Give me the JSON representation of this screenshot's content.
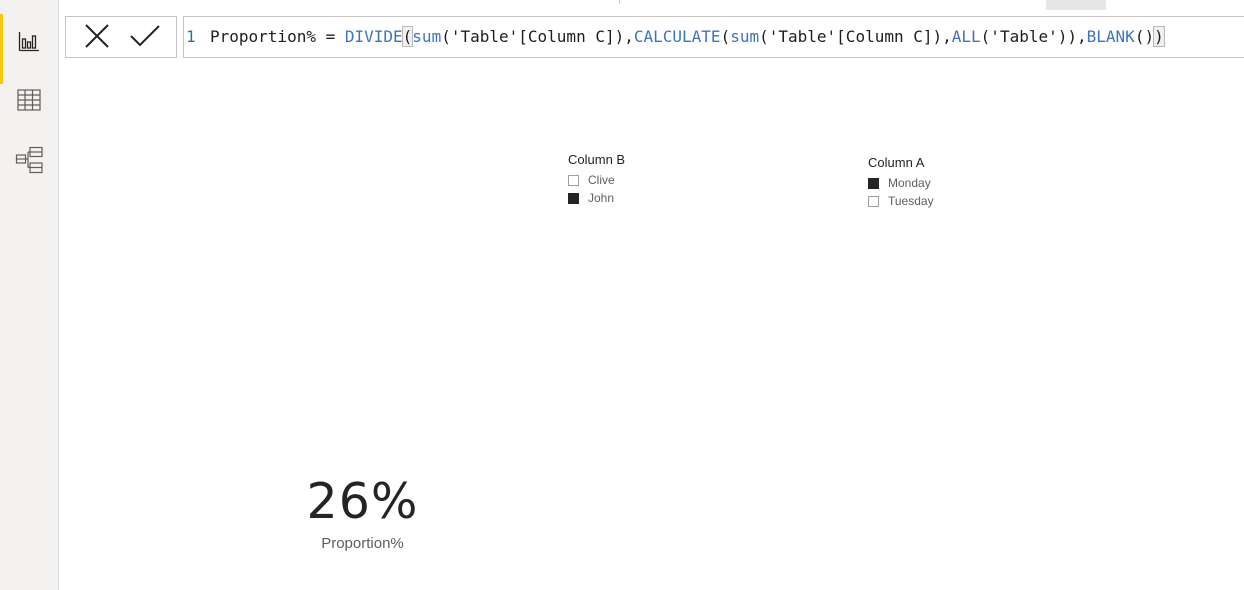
{
  "left_rail": {
    "items": [
      {
        "icon": "report-view-icon",
        "active": true
      },
      {
        "icon": "data-view-icon",
        "active": false
      },
      {
        "icon": "model-view-icon",
        "active": false
      }
    ]
  },
  "formula_bar": {
    "cancel_icon": "close-icon",
    "commit_icon": "checkmark-icon",
    "line_number": "1",
    "tokens": {
      "t1": "Proportion% = ",
      "t2": "DIVIDE",
      "t3": "(",
      "t4": "sum",
      "t5": "('Table'[Column C]),",
      "t6": "CALCULATE",
      "t7": "(",
      "t8": "sum",
      "t9": "('Table'[Column C]),",
      "t10": "ALL",
      "t11": "('Table')),",
      "t12": "BLANK",
      "t13": "()",
      "t14": ")"
    },
    "colors": {
      "function": "#3d74c1",
      "text": "#1e1e1e",
      "line_number": "#237893"
    }
  },
  "slicer_b": {
    "title": "Column B",
    "items": [
      {
        "label": "Clive",
        "checked": false
      },
      {
        "label": "John",
        "checked": true
      }
    ]
  },
  "slicer_a": {
    "title": "Column A",
    "items": [
      {
        "label": "Monday",
        "checked": true
      },
      {
        "label": "Tuesday",
        "checked": false
      }
    ]
  },
  "card": {
    "value": "26%",
    "label": "Proportion%"
  },
  "colors": {
    "accent": "#f2c811",
    "rail_background": "#f3f2f1",
    "checked_box": "#252423"
  }
}
